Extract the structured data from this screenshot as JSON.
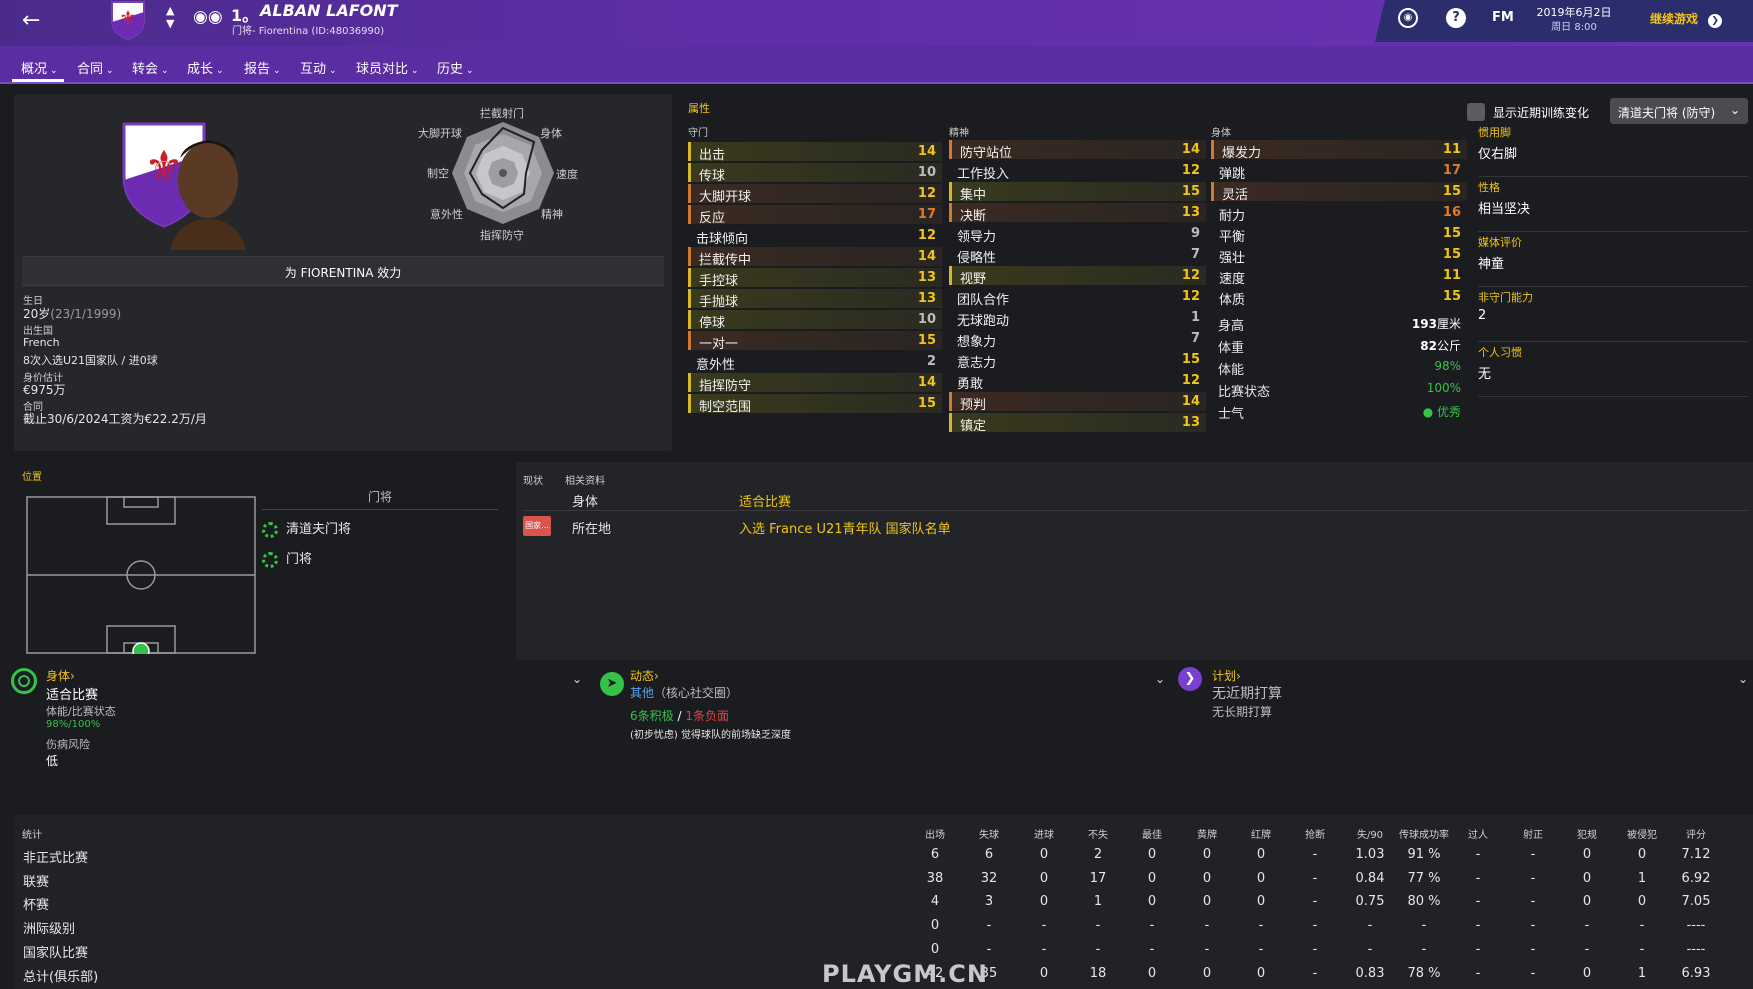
{
  "header": {
    "number": "1。",
    "player_name": "ALBAN LAFONT",
    "subtitle": "门将- Fiorentina (ID:48036990)",
    "date_line1": "2019年6月2日",
    "date_line2": "周日 8:00",
    "continue_label": "继续游戏",
    "fm_label": "FM"
  },
  "nav": {
    "items": [
      "概况",
      "合同",
      "转会",
      "成长",
      "报告",
      "互动",
      "球员对比",
      "历史"
    ]
  },
  "profile": {
    "plays_for": "为 FIORENTINA 效力",
    "radar_labels": {
      "top": "拦截射门",
      "top_left": "大脚开球",
      "top_right": "身体",
      "left": "制空",
      "right": "速度",
      "bottom_left": "意外性",
      "bottom_right": "精神",
      "bottom": "指挥防守"
    },
    "fields": [
      {
        "label": "生日",
        "value": "20岁",
        "extra": "(23/1/1999)"
      },
      {
        "label": "出生国",
        "value": "French",
        "extra": ""
      },
      {
        "label": "",
        "value": "8次入选U21国家队 / 进0球",
        "extra": ""
      },
      {
        "label": "身价估计",
        "value": "€975万",
        "extra": ""
      },
      {
        "label": "合同",
        "value": "截止30/6/2024工资为€22.2万/月",
        "extra": ""
      }
    ]
  },
  "attributes": {
    "section_title": "属性",
    "show_training_label": "显示近期训练变化",
    "role_select": "清道夫门将 (防守)",
    "col1_title": "守门",
    "col2_title": "精神",
    "col3_title": "身体",
    "goalkeeping": [
      {
        "name": "出击",
        "value": "14",
        "hl": "y"
      },
      {
        "name": "传球",
        "value": "10",
        "hl": "y"
      },
      {
        "name": "大脚开球",
        "value": "12",
        "hl": "o"
      },
      {
        "name": "反应",
        "value": "17",
        "hl": "o"
      },
      {
        "name": "击球倾向",
        "value": "12",
        "hl": ""
      },
      {
        "name": "拦截传中",
        "value": "14",
        "hl": "o"
      },
      {
        "name": "手控球",
        "value": "13",
        "hl": "y"
      },
      {
        "name": "手抛球",
        "value": "13",
        "hl": "y"
      },
      {
        "name": "停球",
        "value": "10",
        "hl": "y"
      },
      {
        "name": "一对一",
        "value": "15",
        "hl": "o"
      },
      {
        "name": "意外性",
        "value": "2",
        "hl": ""
      },
      {
        "name": "指挥防守",
        "value": "14",
        "hl": "y"
      },
      {
        "name": "制空范围",
        "value": "15",
        "hl": "y"
      }
    ],
    "mental": [
      {
        "name": "防守站位",
        "value": "14",
        "hl": "o"
      },
      {
        "name": "工作投入",
        "value": "12",
        "hl": ""
      },
      {
        "name": "集中",
        "value": "15",
        "hl": "y"
      },
      {
        "name": "决断",
        "value": "13",
        "hl": "o"
      },
      {
        "name": "领导力",
        "value": "9",
        "hl": ""
      },
      {
        "name": "侵略性",
        "value": "7",
        "hl": ""
      },
      {
        "name": "视野",
        "value": "12",
        "hl": "y"
      },
      {
        "name": "团队合作",
        "value": "12",
        "hl": ""
      },
      {
        "name": "无球跑动",
        "value": "1",
        "hl": ""
      },
      {
        "name": "想象力",
        "value": "7",
        "hl": ""
      },
      {
        "name": "意志力",
        "value": "15",
        "hl": ""
      },
      {
        "name": "勇敢",
        "value": "12",
        "hl": ""
      },
      {
        "name": "预判",
        "value": "14",
        "hl": "o"
      },
      {
        "name": "镇定",
        "value": "13",
        "hl": "y"
      }
    ],
    "physical": [
      {
        "name": "爆发力",
        "value": "11",
        "hl": "o"
      },
      {
        "name": "弹跳",
        "value": "17",
        "hl": ""
      },
      {
        "name": "灵活",
        "value": "15",
        "hl": "o"
      },
      {
        "name": "耐力",
        "value": "16",
        "hl": ""
      },
      {
        "name": "平衡",
        "value": "15",
        "hl": ""
      },
      {
        "name": "强壮",
        "value": "15",
        "hl": ""
      },
      {
        "name": "速度",
        "value": "11",
        "hl": ""
      },
      {
        "name": "体质",
        "value": "15",
        "hl": ""
      }
    ],
    "extra": [
      {
        "name": "身高",
        "value": "193",
        "unit": "厘米"
      },
      {
        "name": "体重",
        "value": "82",
        "unit": "公斤"
      },
      {
        "name": "体能",
        "value": "98%",
        "unit": ""
      },
      {
        "name": "比赛状态",
        "value": "100%",
        "unit": ""
      },
      {
        "name": "士气",
        "value": "优秀",
        "unit": ""
      }
    ],
    "side": [
      {
        "label": "惯用脚",
        "value": "仅右脚"
      },
      {
        "label": "性格",
        "value": "相当坚决"
      },
      {
        "label": "媒体评价",
        "value": "神童"
      },
      {
        "label": "非守门能力",
        "value": "2"
      },
      {
        "label": "个人习惯",
        "value": "无"
      }
    ]
  },
  "position": {
    "title": "位置",
    "header": "门将",
    "roles": [
      "清道夫门将",
      "门将"
    ]
  },
  "status": {
    "tab1": "现状",
    "tab2": "相关资料",
    "rows": [
      {
        "badge": "",
        "key": "身体",
        "value": "适合比赛"
      },
      {
        "badge": "国家...",
        "key": "所在地",
        "value": "入选 France U21青年队 国家队名单"
      }
    ]
  },
  "cards": {
    "physical_title": "身体",
    "physical_status": "适合比赛",
    "physical_sub": "体能/比赛状态",
    "physical_fit": "98%",
    "physical_form": "100%",
    "injury_label": "伤病风险",
    "injury_value": "低",
    "dynamics_title": "动态",
    "dynamics_group": "其他",
    "dynamics_group_extra": "（核心社交圈）",
    "dynamics_pos": "6条积极",
    "dynamics_neg": "1条负面",
    "dynamics_note": "(初步忧虑) 觉得球队的前场缺乏深度",
    "plans_title": "计划",
    "plans_short": "无近期打算",
    "plans_long": "无长期打算"
  },
  "stats": {
    "title": "统计",
    "headers": [
      "出场",
      "失球",
      "进球",
      "不失",
      "最佳",
      "黄牌",
      "红牌",
      "抢断",
      "失/90",
      "传球成功率",
      "过人",
      "射正",
      "犯规",
      "被侵犯",
      "评分"
    ],
    "rows": [
      {
        "name": "非正式比赛",
        "cells": [
          "6",
          "6",
          "0",
          "2",
          "0",
          "0",
          "0",
          "-",
          "1.03",
          "91 %",
          "-",
          "-",
          "0",
          "0",
          "7.12"
        ]
      },
      {
        "name": "联赛",
        "cells": [
          "38",
          "32",
          "0",
          "17",
          "0",
          "0",
          "0",
          "-",
          "0.84",
          "77 %",
          "-",
          "-",
          "0",
          "1",
          "6.92"
        ]
      },
      {
        "name": "杯赛",
        "cells": [
          "4",
          "3",
          "0",
          "1",
          "0",
          "0",
          "0",
          "-",
          "0.75",
          "80 %",
          "-",
          "-",
          "0",
          "0",
          "7.05"
        ]
      },
      {
        "name": "洲际级别",
        "cells": [
          "0",
          "-",
          "-",
          "-",
          "-",
          "-",
          "-",
          "-",
          "-",
          "-",
          "-",
          "-",
          "-",
          "-",
          "----"
        ]
      },
      {
        "name": "国家队比赛",
        "cells": [
          "0",
          "-",
          "-",
          "-",
          "-",
          "-",
          "-",
          "-",
          "-",
          "-",
          "-",
          "-",
          "-",
          "-",
          "----"
        ]
      },
      {
        "name": "总计(俱乐部)",
        "cells": [
          "42",
          "35",
          "0",
          "18",
          "0",
          "0",
          "0",
          "-",
          "0.83",
          "78 %",
          "-",
          "-",
          "0",
          "1",
          "6.93"
        ]
      }
    ]
  },
  "watermark": "PLAYGM.CN",
  "colors": {
    "accent": "#5f2ea8",
    "yellow": "#f0c419",
    "orange": "#e07a2c",
    "green": "#35c24a",
    "red": "#e04444"
  }
}
